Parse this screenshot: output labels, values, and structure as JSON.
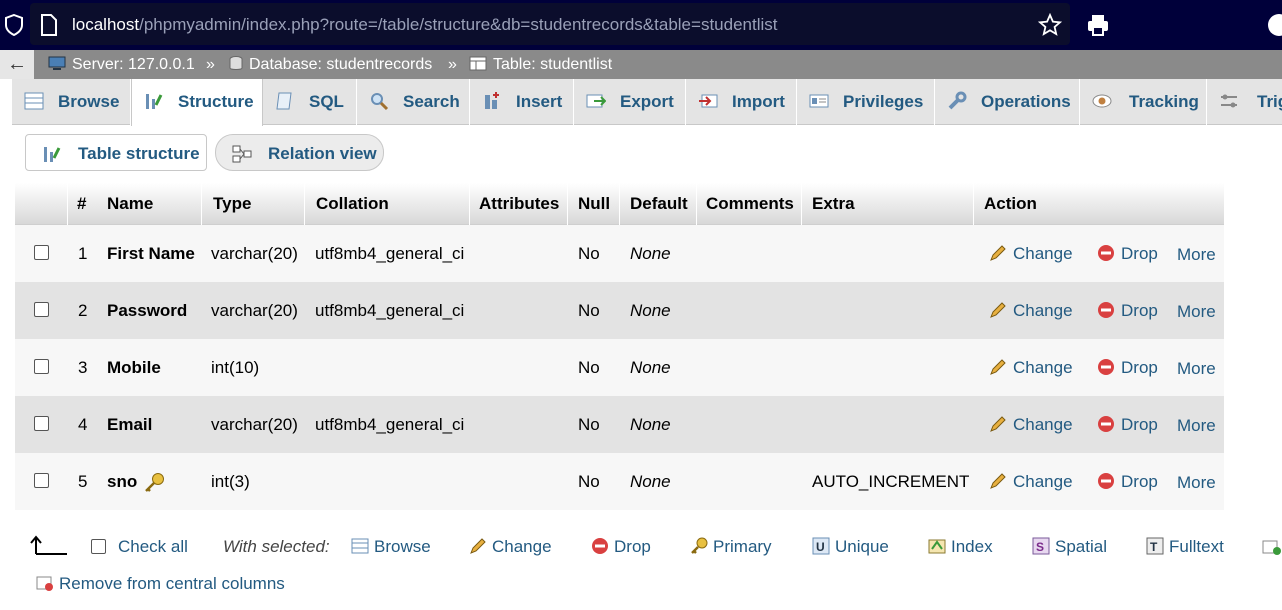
{
  "browser": {
    "url_host": "localhost",
    "url_path": "/phpmyadmin/index.php?route=/table/structure&db=studentrecords&table=studentlist"
  },
  "breadcrumb": {
    "back": "←",
    "server": "Server: 127.0.0.1",
    "sep1": "»",
    "database": "Database: studentrecords",
    "sep2": "»",
    "table": "Table: studentlist"
  },
  "tabs": [
    {
      "label": "Browse"
    },
    {
      "label": "Structure"
    },
    {
      "label": "SQL"
    },
    {
      "label": "Search"
    },
    {
      "label": "Insert"
    },
    {
      "label": "Export"
    },
    {
      "label": "Import"
    },
    {
      "label": "Privileges"
    },
    {
      "label": "Operations"
    },
    {
      "label": "Tracking"
    },
    {
      "label": "Trig"
    }
  ],
  "subtabs": {
    "table_structure": "Table structure",
    "relation_view": "Relation view"
  },
  "table": {
    "headers": {
      "num": "#",
      "name": "Name",
      "type": "Type",
      "collation": "Collation",
      "attributes": "Attributes",
      "null": "Null",
      "default": "Default",
      "comments": "Comments",
      "extra": "Extra",
      "action": "Action"
    },
    "rows": [
      {
        "num": "1",
        "name": "First Name",
        "type": "varchar(20)",
        "collation": "utf8mb4_general_ci",
        "null": "No",
        "default": "None",
        "extra": ""
      },
      {
        "num": "2",
        "name": "Password",
        "type": "varchar(20)",
        "collation": "utf8mb4_general_ci",
        "null": "No",
        "default": "None",
        "extra": ""
      },
      {
        "num": "3",
        "name": "Mobile",
        "type": "int(10)",
        "collation": "",
        "null": "No",
        "default": "None",
        "extra": ""
      },
      {
        "num": "4",
        "name": "Email",
        "type": "varchar(20)",
        "collation": "utf8mb4_general_ci",
        "null": "No",
        "default": "None",
        "extra": ""
      },
      {
        "num": "5",
        "name": "sno",
        "type": "int(3)",
        "collation": "",
        "null": "No",
        "default": "None",
        "extra": "AUTO_INCREMENT"
      }
    ],
    "actions": {
      "change": "Change",
      "drop": "Drop",
      "more": "More"
    }
  },
  "bottom": {
    "check_all": "Check all",
    "with_selected": "With selected:",
    "browse": "Browse",
    "change": "Change",
    "drop": "Drop",
    "primary": "Primary",
    "unique": "Unique",
    "index": "Index",
    "spatial": "Spatial",
    "fulltext": "Fulltext",
    "remove_central": "Remove from central columns"
  }
}
